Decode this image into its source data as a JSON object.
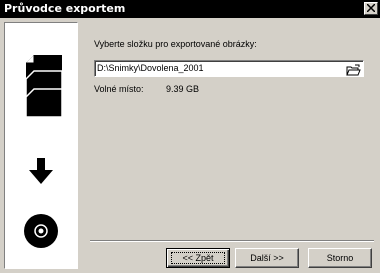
{
  "window": {
    "title": "Průvodce exportem"
  },
  "left_panel": {
    "icons": [
      "documents-stack-icon",
      "arrow-down-icon",
      "disc-icon"
    ]
  },
  "main": {
    "prompt": "Vyberte složku pro exportované obrázky:",
    "path_value": "D:\\Snimky\\Dovolena_2001",
    "free_space_label": "Volné místo:",
    "free_space_value": "9.39 GB"
  },
  "buttons": {
    "back": "<< Zpět",
    "next": "Další >>",
    "cancel": "Storno"
  },
  "colors": {
    "face": "#d4d0c8",
    "titlebar": "#000000",
    "panel": "#ffffff"
  }
}
